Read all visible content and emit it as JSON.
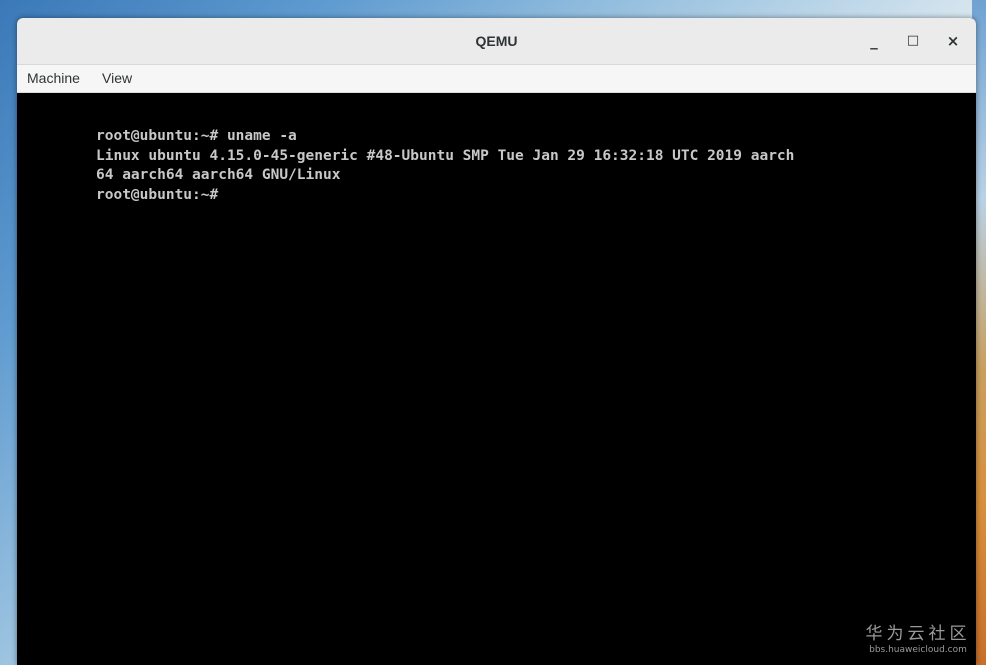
{
  "window": {
    "title": "QEMU",
    "controls": {
      "minimize": "_",
      "maximize": "□",
      "close": "×"
    }
  },
  "menu": {
    "items": [
      "Machine",
      "View"
    ]
  },
  "console": {
    "lines": [
      "root@ubuntu:~# uname -a",
      "Linux ubuntu 4.15.0-45-generic #48-Ubuntu SMP Tue Jan 29 16:32:18 UTC 2019 aarch",
      "64 aarch64 aarch64 GNU/Linux",
      "root@ubuntu:~#"
    ]
  },
  "watermark": {
    "text": "华为云社区",
    "url": "bbs.huaweicloud.com"
  }
}
